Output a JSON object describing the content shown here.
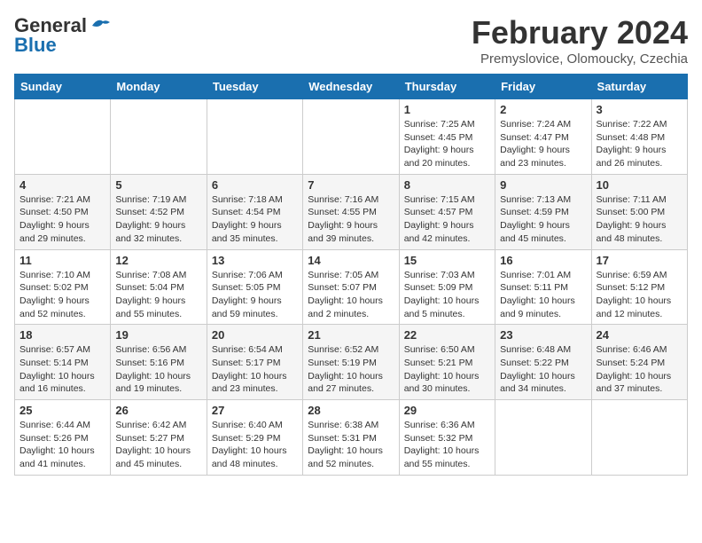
{
  "header": {
    "logo_line1": "General",
    "logo_line2": "Blue",
    "month_title": "February 2024",
    "subtitle": "Premyslovice, Olomoucky, Czechia"
  },
  "weekdays": [
    "Sunday",
    "Monday",
    "Tuesday",
    "Wednesday",
    "Thursday",
    "Friday",
    "Saturday"
  ],
  "weeks": [
    [
      {
        "day": "",
        "info": ""
      },
      {
        "day": "",
        "info": ""
      },
      {
        "day": "",
        "info": ""
      },
      {
        "day": "",
        "info": ""
      },
      {
        "day": "1",
        "info": "Sunrise: 7:25 AM\nSunset: 4:45 PM\nDaylight: 9 hours\nand 20 minutes."
      },
      {
        "day": "2",
        "info": "Sunrise: 7:24 AM\nSunset: 4:47 PM\nDaylight: 9 hours\nand 23 minutes."
      },
      {
        "day": "3",
        "info": "Sunrise: 7:22 AM\nSunset: 4:48 PM\nDaylight: 9 hours\nand 26 minutes."
      }
    ],
    [
      {
        "day": "4",
        "info": "Sunrise: 7:21 AM\nSunset: 4:50 PM\nDaylight: 9 hours\nand 29 minutes."
      },
      {
        "day": "5",
        "info": "Sunrise: 7:19 AM\nSunset: 4:52 PM\nDaylight: 9 hours\nand 32 minutes."
      },
      {
        "day": "6",
        "info": "Sunrise: 7:18 AM\nSunset: 4:54 PM\nDaylight: 9 hours\nand 35 minutes."
      },
      {
        "day": "7",
        "info": "Sunrise: 7:16 AM\nSunset: 4:55 PM\nDaylight: 9 hours\nand 39 minutes."
      },
      {
        "day": "8",
        "info": "Sunrise: 7:15 AM\nSunset: 4:57 PM\nDaylight: 9 hours\nand 42 minutes."
      },
      {
        "day": "9",
        "info": "Sunrise: 7:13 AM\nSunset: 4:59 PM\nDaylight: 9 hours\nand 45 minutes."
      },
      {
        "day": "10",
        "info": "Sunrise: 7:11 AM\nSunset: 5:00 PM\nDaylight: 9 hours\nand 48 minutes."
      }
    ],
    [
      {
        "day": "11",
        "info": "Sunrise: 7:10 AM\nSunset: 5:02 PM\nDaylight: 9 hours\nand 52 minutes."
      },
      {
        "day": "12",
        "info": "Sunrise: 7:08 AM\nSunset: 5:04 PM\nDaylight: 9 hours\nand 55 minutes."
      },
      {
        "day": "13",
        "info": "Sunrise: 7:06 AM\nSunset: 5:05 PM\nDaylight: 9 hours\nand 59 minutes."
      },
      {
        "day": "14",
        "info": "Sunrise: 7:05 AM\nSunset: 5:07 PM\nDaylight: 10 hours\nand 2 minutes."
      },
      {
        "day": "15",
        "info": "Sunrise: 7:03 AM\nSunset: 5:09 PM\nDaylight: 10 hours\nand 5 minutes."
      },
      {
        "day": "16",
        "info": "Sunrise: 7:01 AM\nSunset: 5:11 PM\nDaylight: 10 hours\nand 9 minutes."
      },
      {
        "day": "17",
        "info": "Sunrise: 6:59 AM\nSunset: 5:12 PM\nDaylight: 10 hours\nand 12 minutes."
      }
    ],
    [
      {
        "day": "18",
        "info": "Sunrise: 6:57 AM\nSunset: 5:14 PM\nDaylight: 10 hours\nand 16 minutes."
      },
      {
        "day": "19",
        "info": "Sunrise: 6:56 AM\nSunset: 5:16 PM\nDaylight: 10 hours\nand 19 minutes."
      },
      {
        "day": "20",
        "info": "Sunrise: 6:54 AM\nSunset: 5:17 PM\nDaylight: 10 hours\nand 23 minutes."
      },
      {
        "day": "21",
        "info": "Sunrise: 6:52 AM\nSunset: 5:19 PM\nDaylight: 10 hours\nand 27 minutes."
      },
      {
        "day": "22",
        "info": "Sunrise: 6:50 AM\nSunset: 5:21 PM\nDaylight: 10 hours\nand 30 minutes."
      },
      {
        "day": "23",
        "info": "Sunrise: 6:48 AM\nSunset: 5:22 PM\nDaylight: 10 hours\nand 34 minutes."
      },
      {
        "day": "24",
        "info": "Sunrise: 6:46 AM\nSunset: 5:24 PM\nDaylight: 10 hours\nand 37 minutes."
      }
    ],
    [
      {
        "day": "25",
        "info": "Sunrise: 6:44 AM\nSunset: 5:26 PM\nDaylight: 10 hours\nand 41 minutes."
      },
      {
        "day": "26",
        "info": "Sunrise: 6:42 AM\nSunset: 5:27 PM\nDaylight: 10 hours\nand 45 minutes."
      },
      {
        "day": "27",
        "info": "Sunrise: 6:40 AM\nSunset: 5:29 PM\nDaylight: 10 hours\nand 48 minutes."
      },
      {
        "day": "28",
        "info": "Sunrise: 6:38 AM\nSunset: 5:31 PM\nDaylight: 10 hours\nand 52 minutes."
      },
      {
        "day": "29",
        "info": "Sunrise: 6:36 AM\nSunset: 5:32 PM\nDaylight: 10 hours\nand 55 minutes."
      },
      {
        "day": "",
        "info": ""
      },
      {
        "day": "",
        "info": ""
      }
    ]
  ]
}
